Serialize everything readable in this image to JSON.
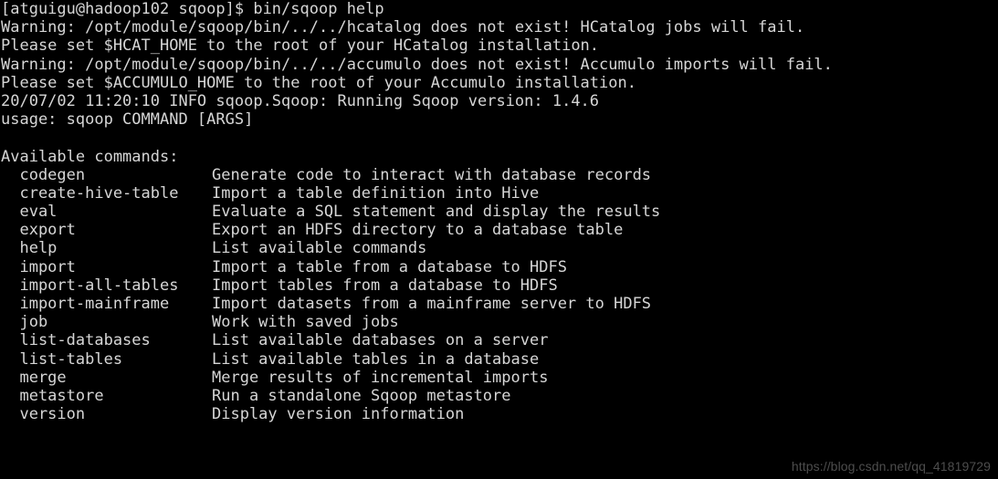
{
  "terminal": {
    "background_color": "#000000",
    "foreground_color": "#d6d6d6",
    "prompt_line": "[atguigu@hadoop102 sqoop]$ bin/sqoop help",
    "output_lines": [
      "Warning: /opt/module/sqoop/bin/../../hcatalog does not exist! HCatalog jobs will fail.",
      "Please set $HCAT_HOME to the root of your HCatalog installation.",
      "Warning: /opt/module/sqoop/bin/../../accumulo does not exist! Accumulo imports will fail.",
      "Please set $ACCUMULO_HOME to the root of your Accumulo installation.",
      "20/07/02 11:20:10 INFO sqoop.Sqoop: Running Sqoop version: 1.4.6",
      "usage: sqoop COMMAND [ARGS]"
    ],
    "blank_line": " ",
    "commands_heading": "Available commands:",
    "commands": [
      {
        "name": "  codegen",
        "desc": "Generate code to interact with database records"
      },
      {
        "name": "  create-hive-table",
        "desc": "Import a table definition into Hive"
      },
      {
        "name": "  eval",
        "desc": "Evaluate a SQL statement and display the results"
      },
      {
        "name": "  export",
        "desc": "Export an HDFS directory to a database table"
      },
      {
        "name": "  help",
        "desc": "List available commands"
      },
      {
        "name": "  import",
        "desc": "Import a table from a database to HDFS"
      },
      {
        "name": "  import-all-tables",
        "desc": "Import tables from a database to HDFS"
      },
      {
        "name": "  import-mainframe",
        "desc": "Import datasets from a mainframe server to HDFS"
      },
      {
        "name": "  job",
        "desc": "Work with saved jobs"
      },
      {
        "name": "  list-databases",
        "desc": "List available databases on a server"
      },
      {
        "name": "  list-tables",
        "desc": "List available tables in a database"
      },
      {
        "name": "  merge",
        "desc": "Merge results of incremental imports"
      },
      {
        "name": "  metastore",
        "desc": "Run a standalone Sqoop metastore"
      },
      {
        "name": "  version",
        "desc": "Display version information"
      }
    ]
  },
  "watermark": {
    "text": "https://blog.csdn.net/qq_41819729",
    "color": "#4d4d4d"
  }
}
